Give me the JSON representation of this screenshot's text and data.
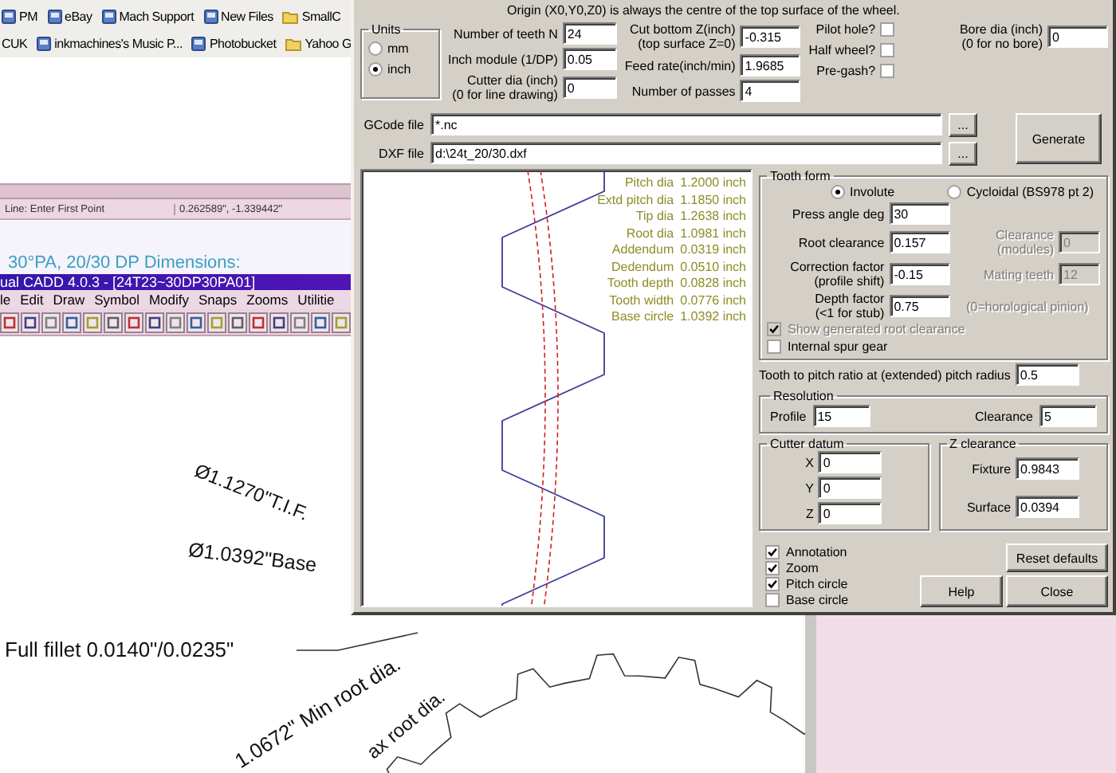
{
  "browser": {
    "bookmark_rows": [
      {
        "items": [
          {
            "label": "PM",
            "kind": "site"
          },
          {
            "label": "eBay",
            "kind": "site"
          },
          {
            "label": "Mach Support",
            "kind": "site"
          },
          {
            "label": "New Files",
            "kind": "site"
          },
          {
            "label": "SmallC",
            "kind": "folder"
          }
        ]
      },
      {
        "items": [
          {
            "label": "CUK",
            "kind": "plain"
          },
          {
            "label": "inkmachines's Music P...",
            "kind": "site"
          },
          {
            "label": "Photobucket",
            "kind": "site"
          },
          {
            "label": "Yahoo G",
            "kind": "folder"
          }
        ]
      }
    ]
  },
  "cad_window": {
    "status_prompt": "Line: Enter First Point",
    "coordinates": "0.262589\", -1.339442\"",
    "heading": "30°PA, 20/30 DP Dimensions:",
    "title": "ual CADD 4.0.3 - [24T23~30DP30PA01]",
    "menu": [
      "le",
      "Edit",
      "Draw",
      "Symbol",
      "Modify",
      "Snaps",
      "Zooms",
      "Utilitie"
    ],
    "annotations": [
      {
        "text": "Ø1.1270\"T.I.F."
      },
      {
        "text": "Ø1.0392\"Base"
      },
      {
        "text": "Full fillet 0.0140\"/0.0235\""
      },
      {
        "text": "1.0672\" Min root dia."
      },
      {
        "text": "ax root dia."
      }
    ]
  },
  "dialog": {
    "origin_note": "Origin (X0,Y0,Z0) is always the centre of the top surface of the wheel.",
    "units": {
      "title": "Units",
      "options": [
        {
          "label": "mm",
          "selected": false
        },
        {
          "label": "inch",
          "selected": true
        }
      ]
    },
    "gear_fields": [
      {
        "label": "Number of teeth N",
        "value": "24"
      },
      {
        "label": "Inch module (1/DP)",
        "value": "0.05"
      },
      {
        "label": "Cutter dia (inch)",
        "hint": "(0 for line drawing)",
        "value": "0"
      }
    ],
    "cut_fields": [
      {
        "label": "Cut bottom Z(inch)",
        "hint": "(top surface Z=0)",
        "value": "-0.315"
      },
      {
        "label": "Feed rate(inch/min)",
        "value": "1.9685"
      },
      {
        "label": "Number of passes",
        "value": "4"
      }
    ],
    "options": [
      {
        "label": "Pilot hole?",
        "checked": false
      },
      {
        "label": "Half wheel?",
        "checked": false
      },
      {
        "label": "Pre-gash?",
        "checked": false
      }
    ],
    "bore": {
      "label": "Bore dia (inch)",
      "hint": "(0 for no bore)",
      "value": "0"
    },
    "files": [
      {
        "label": "GCode file",
        "value": "*.nc",
        "button": "..."
      },
      {
        "label": "DXF file",
        "value": "d:\\24t_20/30.dxf",
        "button": "..."
      }
    ],
    "generate": "Generate",
    "results": [
      {
        "label": "Pitch dia",
        "value": "1.2000 inch"
      },
      {
        "label": "Extd pitch dia",
        "value": "1.1850 inch"
      },
      {
        "label": "Tip dia",
        "value": "1.2638 inch"
      },
      {
        "label": "Root dia",
        "value": "1.0981 inch"
      },
      {
        "label": "Addendum",
        "value": "0.0319 inch"
      },
      {
        "label": "Dedendum",
        "value": "0.0510 inch"
      },
      {
        "label": "Tooth depth",
        "value": "0.0828 inch"
      },
      {
        "label": "Tooth width",
        "value": "0.0776 inch"
      },
      {
        "label": "Base circle",
        "value": "1.0392 inch"
      }
    ],
    "tooth_form": {
      "title": "Tooth form",
      "options": [
        {
          "label": "Involute",
          "selected": true
        },
        {
          "label": "Cycloidal (BS978 pt 2)",
          "selected": false
        }
      ],
      "fields": [
        {
          "label": "Press angle deg",
          "value": "30"
        },
        {
          "label": "Root clearance",
          "value": "0.157"
        },
        {
          "label": "Correction factor",
          "hint": "(profile shift)",
          "value": "-0.15"
        },
        {
          "label": "Depth factor",
          "hint": "(<1 for stub)",
          "value": "0.75"
        }
      ],
      "cycloidal_fields": [
        {
          "label": "Clearance",
          "hint": "(modules)",
          "value": "0",
          "disabled": true
        },
        {
          "label": "Mating teeth",
          "value": "12",
          "disabled": true
        }
      ],
      "cycloidal_note": "(0=horological pinion)",
      "checks": [
        {
          "label": "Show generated root clearance",
          "checked": true,
          "disabled": true
        },
        {
          "label": "Internal spur gear",
          "checked": false,
          "disabled": false
        }
      ]
    },
    "tooth_ratio": {
      "label": "Tooth to pitch ratio at (extended) pitch radius",
      "value": "0.5"
    },
    "resolution": {
      "title": "Resolution",
      "fields": [
        {
          "label": "Profile",
          "value": "15"
        },
        {
          "label": "Clearance",
          "value": "5"
        }
      ]
    },
    "cutter_datum": {
      "title": "Cutter datum",
      "fields": [
        {
          "label": "X",
          "value": "0"
        },
        {
          "label": "Y",
          "value": "0"
        },
        {
          "label": "Z",
          "value": "0"
        }
      ]
    },
    "z_clearance": {
      "title": "Z clearance",
      "fields": [
        {
          "label": "Fixture",
          "value": "0.9843"
        },
        {
          "label": "Surface",
          "value": "0.0394"
        }
      ]
    },
    "display_options": [
      {
        "label": "Annotation",
        "checked": true
      },
      {
        "label": "Zoom",
        "checked": true
      },
      {
        "label": "Pitch circle",
        "checked": true
      },
      {
        "label": "Base circle",
        "checked": false
      }
    ],
    "buttons": [
      {
        "label": "Reset defaults"
      },
      {
        "label": "Help"
      },
      {
        "label": "Close"
      }
    ]
  }
}
